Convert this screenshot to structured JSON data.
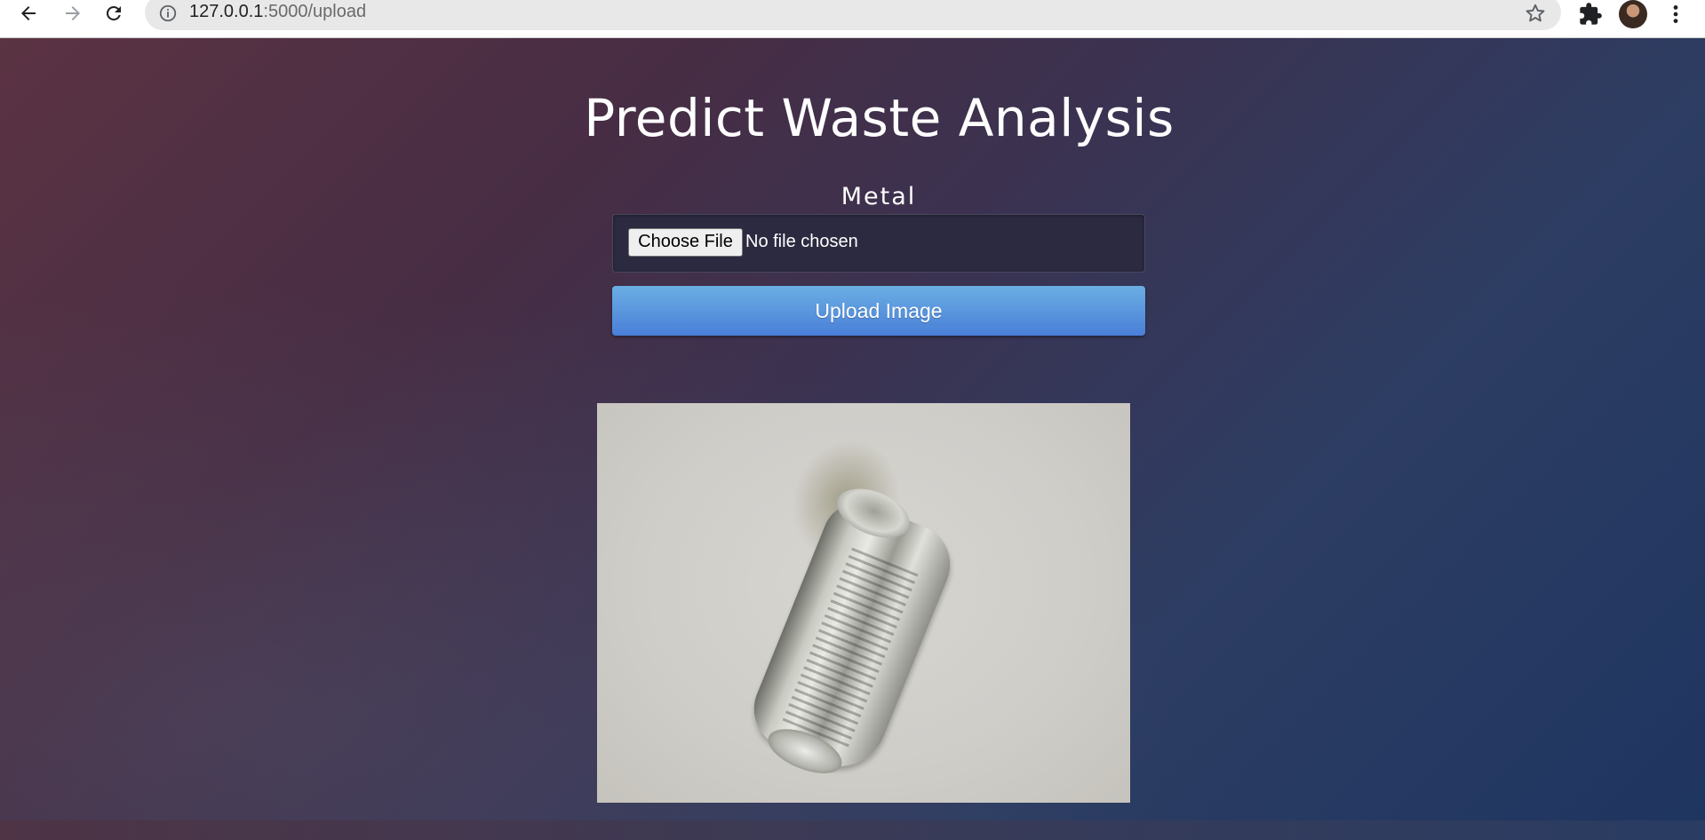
{
  "browser": {
    "url_host": "127.0.0.1",
    "url_path": ":5000/upload"
  },
  "page": {
    "title": "Predict Waste Analysis",
    "prediction": "Metal",
    "file_input": {
      "button_label": "Choose File",
      "status_text": "No file chosen"
    },
    "upload_button_label": "Upload Image"
  },
  "colors": {
    "upload_button_top": "#6aaee3",
    "upload_button_bottom": "#4a7fd8",
    "background_left": "#5b3343",
    "background_right": "#1e3560"
  }
}
